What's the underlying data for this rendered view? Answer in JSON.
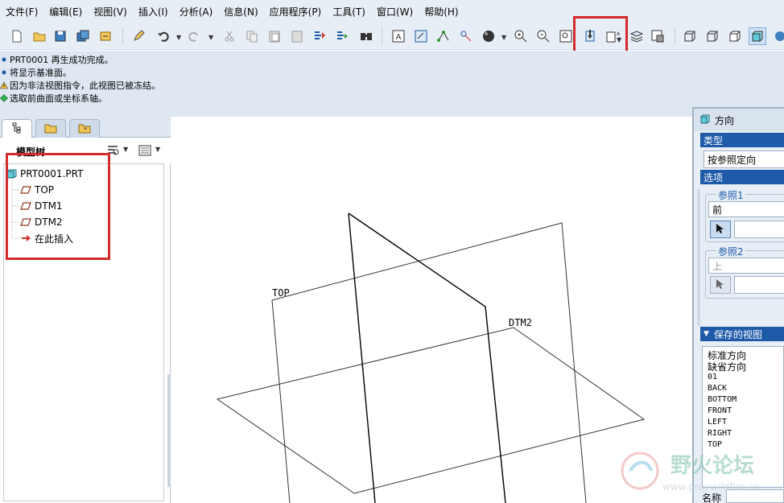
{
  "menubar": {
    "items": [
      "文件(F)",
      "编辑(E)",
      "视图(V)",
      "插入(I)",
      "分析(A)",
      "信息(N)",
      "应用程序(P)",
      "工具(T)",
      "窗口(W)",
      "帮助(H)"
    ]
  },
  "toolbar": {
    "icons": [
      "new-file-icon",
      "open-folder-icon",
      "save-icon",
      "save-copy-icon",
      "backup-icon",
      "edit-definition-icon",
      "undo-icon",
      "redo-icon",
      "cut-icon",
      "copy-icon",
      "paste-icon",
      "paste-special-icon",
      "regenerate-icon",
      "regenerate-manager-icon",
      "find-icon",
      "annotation-icon",
      "sketch-icon",
      "datum-point-icon",
      "axis-icon",
      "sphere-icon",
      "zoom-in-icon",
      "zoom-out-icon",
      "refit-icon",
      "reorient-icon",
      "saved-views-icon",
      "layers-icon",
      "view-manager-icon",
      "wireframe-icon",
      "hidden-line-icon",
      "no-hidden-icon",
      "shading-icon",
      "render-icon"
    ]
  },
  "messages": [
    {
      "icon": "info-bullet-icon",
      "text": "PRT0001 再生成功完成。"
    },
    {
      "icon": "info-bullet-icon",
      "text": "将显示基准面。"
    },
    {
      "icon": "warning-icon",
      "text": "因为非法视图指令，此视图已被冻结。"
    },
    {
      "icon": "prompt-diamond-icon",
      "text": "选取前曲面或坐标系轴。"
    }
  ],
  "model_tree": {
    "title": "模型树",
    "root": "PRT0001.PRT",
    "nodes": [
      "TOP",
      "DTM1",
      "DTM2"
    ],
    "insert_here": "在此插入"
  },
  "graphics": {
    "labels": {
      "top": "TOP",
      "dtm2": "DTM2"
    }
  },
  "orientation_dialog": {
    "title": "方向",
    "type_section": "类型",
    "type_value": "按参照定向",
    "options_section": "选项",
    "ref1_label": "参照1",
    "ref1_value": "前",
    "ref2_label": "参照2",
    "ref2_value": "上",
    "saved_views_section": "保存的视图",
    "saved_views": [
      "标准方向",
      "缺省方向",
      "01",
      "BACK",
      "BOTTOM",
      "FRONT",
      "LEFT",
      "RIGHT",
      "TOP"
    ],
    "name_label": "名称"
  },
  "watermark": {
    "title": "野火论坛",
    "url": "www.proewildfire.cn"
  },
  "colors": {
    "highlight_red": "#d42b2b",
    "section_blue": "#1e5aa8",
    "panel_bg": "#e8eef5"
  }
}
